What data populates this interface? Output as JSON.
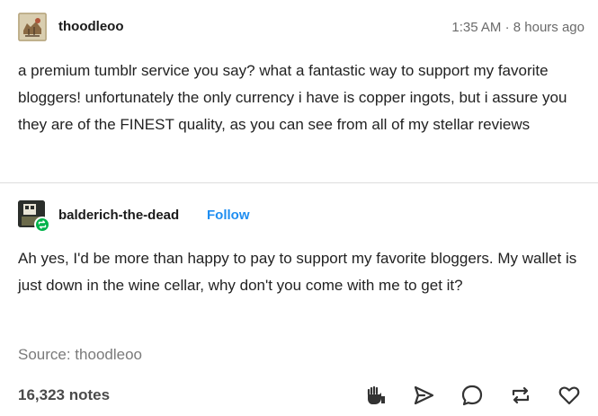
{
  "post": {
    "author": "thoodleoo",
    "time": "1:35 AM",
    "separator": "·",
    "relative_time": "8 hours ago",
    "body": "a premium tumblr service you say? what a fantastic way to support my favorite bloggers! unfortunately the only currency i have is copper ingots, but i assure you they are of the FINEST quality, as you can see from all of my stellar reviews"
  },
  "reply": {
    "author": "balderich-the-dead",
    "follow_label": "Follow",
    "body": "Ah yes, I'd be more than happy to pay to support my favorite bloggers. My wallet is just down in the wine cellar, why don't you come with me to get it?"
  },
  "source_label": "Source: thoodleoo",
  "notes_label": "16,323 notes",
  "actions": [
    {
      "icon": "tip-hand-icon"
    },
    {
      "icon": "share-icon"
    },
    {
      "icon": "reply-icon"
    },
    {
      "icon": "reblog-icon"
    },
    {
      "icon": "like-icon"
    }
  ],
  "colors": {
    "follow": "#1f8ef1",
    "reblog_badge": "#00b34a",
    "muted_text": "#6b6b6b"
  }
}
